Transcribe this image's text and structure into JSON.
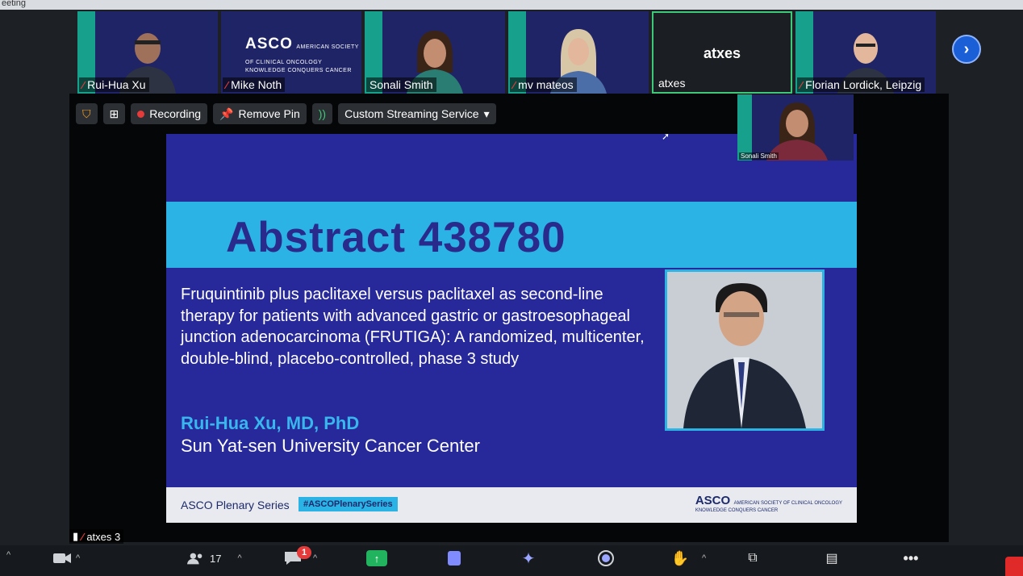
{
  "window": {
    "top_text": "eeting"
  },
  "participants": [
    {
      "name": "Rui-Hua Xu",
      "muted": true
    },
    {
      "name": "Mike Noth",
      "muted": true
    },
    {
      "name": "Sonali Smith",
      "muted": false
    },
    {
      "name": "mv mateos",
      "muted": true
    },
    {
      "name": "atxes",
      "muted": false,
      "display_name": "atxes"
    },
    {
      "name": "Florian Lordick, Leipzig",
      "muted": true
    }
  ],
  "asco_tile": {
    "logo_text": "ASCO",
    "logo_small": "AMERICAN SOCIETY OF CLINICAL ONCOLOGY",
    "tagline": "KNOWLEDGE CONQUERS CANCER"
  },
  "toolbar": {
    "recording_label": "Recording",
    "remove_pin_label": "Remove Pin",
    "streaming_label": "Custom Streaming Service"
  },
  "slide": {
    "title": "Abstract 438780",
    "abstract_text": "Fruquintinib plus paclitaxel versus paclitaxel as second-line therapy for patients with advanced gastric or gastroesophageal junction adenocarcinoma (FRUTIGA): A randomized, multicenter, double-blind, placebo-controlled, phase 3 study",
    "author": "Rui-Hua Xu, MD, PhD",
    "institution": "Sun Yat-sen University Cancer Center",
    "footer_series": "ASCO Plenary Series",
    "footer_hashtag": "#ASCOPlenarySeries",
    "footer_logo": "ASCO",
    "footer_logo_small": "AMERICAN SOCIETY OF CLINICAL ONCOLOGY",
    "footer_tagline": "KNOWLEDGE CONQUERS CANCER"
  },
  "pip": {
    "name": "Sonali Smith"
  },
  "self_view": {
    "name": "atxes 3"
  },
  "bottom_bar": {
    "participants_count": "17",
    "chat_badge": "1"
  },
  "colors": {
    "slide_bg": "#27289a",
    "band": "#2bb3e6",
    "accent_green": "#3ec978"
  }
}
